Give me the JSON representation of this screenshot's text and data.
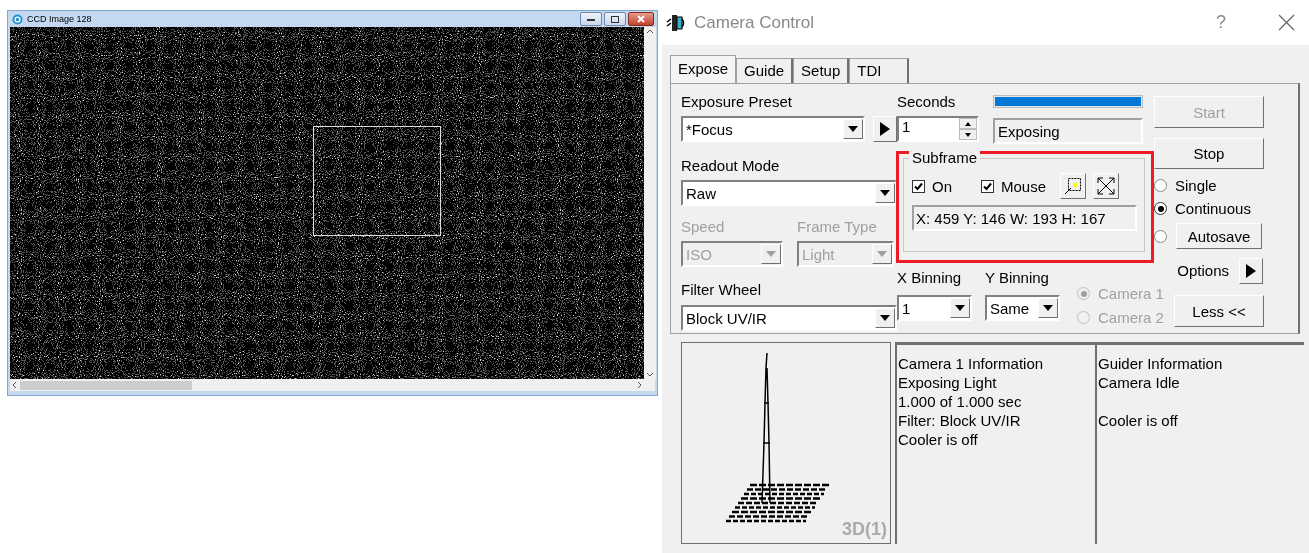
{
  "image_window": {
    "title": "CCD Image 128"
  },
  "dialog": {
    "title": "Camera Control",
    "help": "?"
  },
  "tabs": [
    {
      "label": "Expose",
      "selected": true
    },
    {
      "label": "Guide",
      "selected": false
    },
    {
      "label": "Setup",
      "selected": false
    },
    {
      "label": "TDI",
      "selected": false
    }
  ],
  "exposure_preset": {
    "label": "Exposure Preset",
    "value": "*Focus"
  },
  "readout_mode": {
    "label": "Readout Mode",
    "value": "Raw"
  },
  "speed": {
    "label": "Speed",
    "value": "ISO",
    "disabled": true
  },
  "frame_type": {
    "label": "Frame Type",
    "value": "Light",
    "disabled": true
  },
  "filter_wheel": {
    "label": "Filter Wheel",
    "value": "Block UV/IR"
  },
  "seconds": {
    "label": "Seconds",
    "value": "1"
  },
  "progress": {
    "level": 1.0
  },
  "status": "Exposing",
  "subframe": {
    "title": "Subframe",
    "coords": "X: 459 Y: 146 W: 193 H: 167",
    "checks": [
      {
        "label": "On",
        "checked": true
      },
      {
        "label": "Mouse",
        "checked": true
      }
    ]
  },
  "x_binning": {
    "label": "X Binning",
    "value": "1"
  },
  "y_binning": {
    "label": "Y Binning",
    "value": "Same"
  },
  "cameras": [
    {
      "label": "Camera 1",
      "selected": true,
      "disabled": true
    },
    {
      "label": "Camera 2",
      "selected": false,
      "disabled": true
    }
  ],
  "start_button": {
    "label": "Start",
    "disabled": true
  },
  "stop_button": {
    "label": "Stop",
    "disabled": false
  },
  "modes": [
    {
      "kind": "label",
      "label": "Single",
      "selected": false
    },
    {
      "kind": "label",
      "label": "Continuous",
      "selected": true
    },
    {
      "kind": "button",
      "label": "Autosave",
      "selected": false
    }
  ],
  "options_label": "Options",
  "less_button": "Less <<",
  "preview": {
    "caption": "3D(1)"
  },
  "camera_info": [
    [
      "Camera 1 Information",
      "Exposing Light",
      "1.000 of 1.000 sec",
      "Filter: Block UV/IR",
      "Cooler is off"
    ]
  ],
  "guider_info": [
    [
      "Guider Information",
      "Camera Idle"
    ],
    [
      "Cooler is off"
    ]
  ]
}
